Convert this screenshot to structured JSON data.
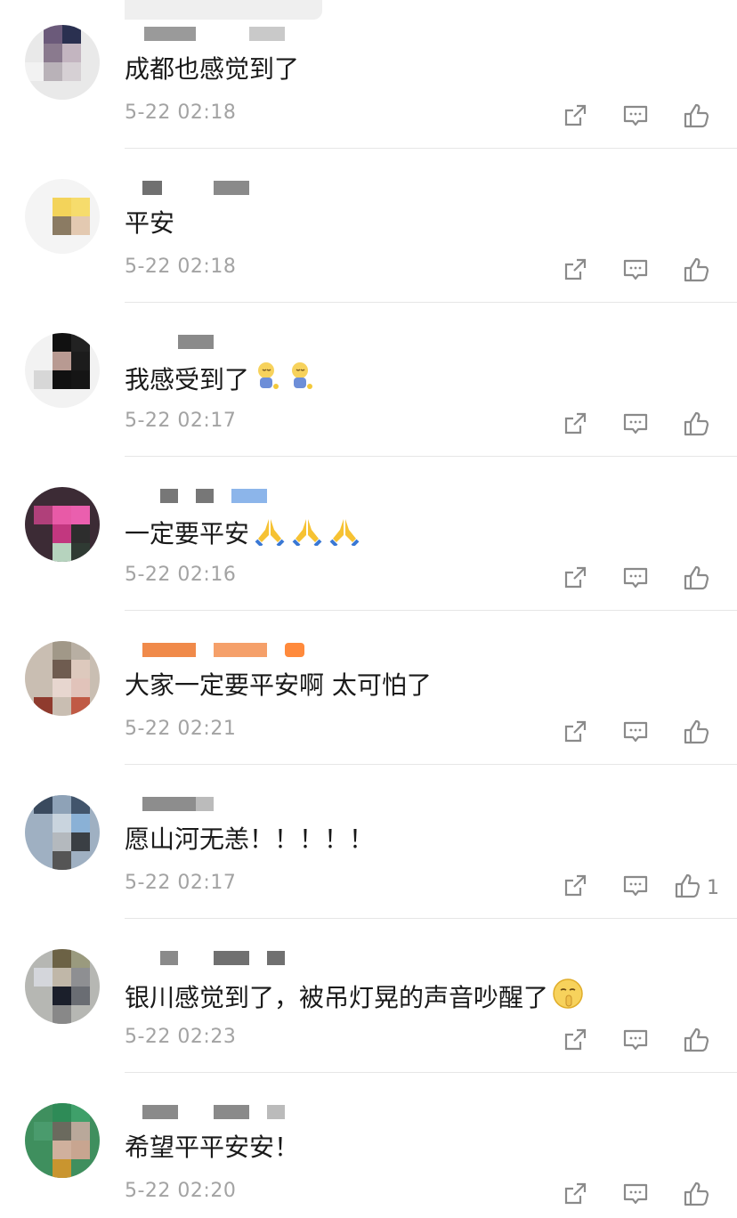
{
  "comments": [
    {
      "text": "成都也感觉到了",
      "time": "5-22 02:18",
      "likes": ""
    },
    {
      "text": "平安",
      "time": "5-22 02:18",
      "likes": ""
    },
    {
      "text": "我感受到了",
      "time": "5-22 02:17",
      "likes": ""
    },
    {
      "text": "一定要平安",
      "time": "5-22 02:16",
      "likes": ""
    },
    {
      "text": "大家一定要平安啊 太可怕了",
      "time": "5-22 02:21",
      "likes": ""
    },
    {
      "text": "愿山河无恙！！！！！",
      "time": "5-22 02:17",
      "likes": "1"
    },
    {
      "text": "银川感觉到了，被吊灯晃的声音吵醒了",
      "time": "5-22 02:23",
      "likes": ""
    },
    {
      "text": "希望平平安安！",
      "time": "5-22 02:20",
      "likes": ""
    }
  ],
  "icons": {
    "share": "share-icon",
    "reply": "comment-icon",
    "like": "thumbs-up-icon"
  },
  "colors": {
    "text": "#1a1a1a",
    "timestamp": "#a3a3a3",
    "icon": "#8a8a8a"
  }
}
